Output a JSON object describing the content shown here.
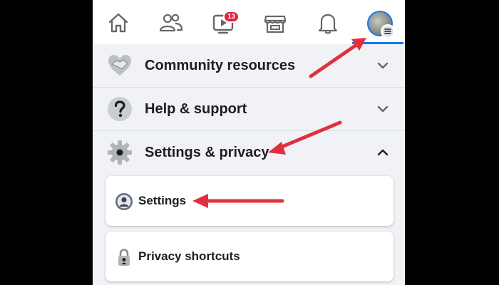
{
  "top_nav": {
    "items": [
      {
        "name": "home",
        "icon": "home-icon"
      },
      {
        "name": "friends",
        "icon": "friends-icon"
      },
      {
        "name": "watch",
        "icon": "watch-icon",
        "badge": "13"
      },
      {
        "name": "marketplace",
        "icon": "marketplace-icon"
      },
      {
        "name": "notifications",
        "icon": "bell-icon"
      },
      {
        "name": "menu",
        "icon": "profile-avatar",
        "active": true
      }
    ],
    "active_color": "#1877f2",
    "badge_color": "#e41e3f"
  },
  "menu": {
    "sections": [
      {
        "label": "Community resources",
        "icon": "handshake-icon",
        "expanded": false
      },
      {
        "label": "Help & support",
        "icon": "question-icon",
        "expanded": false
      },
      {
        "label": "Settings & privacy",
        "icon": "gear-icon",
        "expanded": true
      }
    ],
    "submenu": [
      {
        "label": "Settings",
        "icon": "user-circle-icon"
      },
      {
        "label": "Privacy shortcuts",
        "icon": "lock-icon"
      }
    ]
  },
  "annotations": {
    "arrow_color": "#e0303e",
    "arrow_count": 3
  }
}
